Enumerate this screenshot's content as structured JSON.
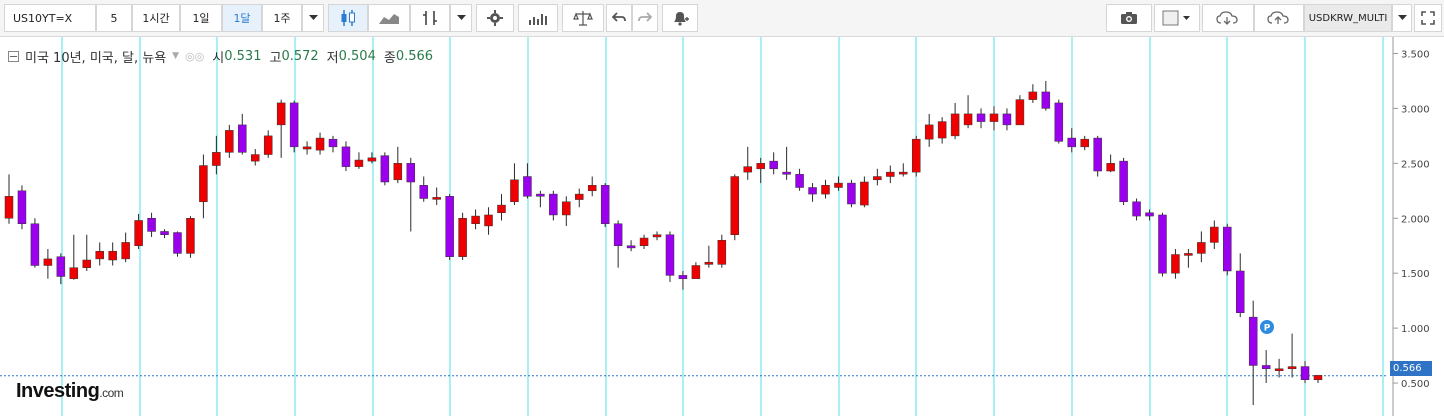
{
  "toolbar": {
    "symbol": "US10YT=X",
    "intervals": [
      "5",
      "1시간",
      "1일",
      "1달",
      "1주"
    ],
    "active_interval": "1달",
    "compare_symbol": "USDKRW_MULTI"
  },
  "legend": {
    "title": "미국 10년, 미국, 달, 뉴욕",
    "open_label": "시",
    "open": "0.531",
    "high_label": "고",
    "high": "0.572",
    "low_label": "저",
    "low": "0.504",
    "close_label": "종",
    "close": "0.566"
  },
  "colors": {
    "up": "#ee0000",
    "down": "#9b00ee",
    "grid": "#4fe0e8",
    "badge": "#2e73c6"
  },
  "price_badge": "0.566",
  "marker_label": "P",
  "logo": {
    "main": "Investing",
    "suffix": ".com"
  },
  "chart_data": {
    "type": "candlestick",
    "y_ticks": [
      "3.500",
      "3.000",
      "2.500",
      "2.000",
      "1.500",
      "1.000",
      "0.500"
    ],
    "y_tick_values": [
      3.5,
      3.0,
      2.5,
      2.0,
      1.5,
      1.0,
      0.5
    ],
    "ylim": [
      0.2,
      3.65
    ],
    "current_price": 0.566,
    "candles": [
      [
        2.0,
        2.2,
        2.4,
        1.95
      ],
      [
        2.25,
        1.95,
        2.3,
        1.9
      ],
      [
        1.95,
        1.57,
        2.0,
        1.55
      ],
      [
        1.57,
        1.63,
        1.72,
        1.45
      ],
      [
        1.65,
        1.47,
        1.68,
        1.4
      ],
      [
        1.45,
        1.55,
        1.85,
        1.44
      ],
      [
        1.55,
        1.62,
        1.85,
        1.52
      ],
      [
        1.63,
        1.7,
        1.78,
        1.57
      ],
      [
        1.62,
        1.7,
        1.78,
        1.57
      ],
      [
        1.63,
        1.78,
        1.87,
        1.6
      ],
      [
        1.75,
        1.98,
        2.04,
        1.72
      ],
      [
        2.0,
        1.88,
        2.05,
        1.83
      ],
      [
        1.88,
        1.85,
        1.9,
        1.82
      ],
      [
        1.87,
        1.68,
        1.88,
        1.65
      ],
      [
        1.68,
        2.0,
        2.02,
        1.64
      ],
      [
        2.15,
        2.48,
        2.58,
        2.0
      ],
      [
        2.48,
        2.6,
        2.75,
        2.4
      ],
      [
        2.6,
        2.8,
        2.85,
        2.55
      ],
      [
        2.85,
        2.6,
        2.95,
        2.58
      ],
      [
        2.52,
        2.58,
        2.63,
        2.48
      ],
      [
        2.58,
        2.75,
        2.8,
        2.55
      ],
      [
        2.85,
        3.05,
        3.08,
        2.55
      ],
      [
        3.05,
        2.65,
        3.07,
        2.6
      ],
      [
        2.63,
        2.65,
        2.7,
        2.58
      ],
      [
        2.62,
        2.73,
        2.78,
        2.58
      ],
      [
        2.72,
        2.65,
        2.75,
        2.6
      ],
      [
        2.65,
        2.47,
        2.7,
        2.43
      ],
      [
        2.47,
        2.53,
        2.6,
        2.45
      ],
      [
        2.52,
        2.55,
        2.6,
        2.5
      ],
      [
        2.57,
        2.33,
        2.6,
        2.3
      ],
      [
        2.35,
        2.5,
        2.65,
        2.32
      ],
      [
        2.5,
        2.33,
        2.55,
        1.88
      ],
      [
        2.3,
        2.18,
        2.38,
        2.15
      ],
      [
        2.18,
        2.19,
        2.28,
        2.12
      ],
      [
        2.2,
        1.65,
        2.22,
        1.62
      ],
      [
        1.65,
        2.0,
        2.05,
        1.62
      ],
      [
        1.95,
        2.02,
        2.08,
        1.9
      ],
      [
        1.93,
        2.03,
        2.1,
        1.85
      ],
      [
        2.05,
        2.12,
        2.22,
        1.98
      ],
      [
        2.15,
        2.35,
        2.5,
        2.12
      ],
      [
        2.38,
        2.2,
        2.5,
        2.18
      ],
      [
        2.22,
        2.2,
        2.25,
        2.1
      ],
      [
        2.22,
        2.03,
        2.25,
        1.98
      ],
      [
        2.03,
        2.15,
        2.2,
        1.93
      ],
      [
        2.17,
        2.22,
        2.27,
        2.1
      ],
      [
        2.25,
        2.3,
        2.38,
        2.2
      ],
      [
        2.3,
        1.95,
        2.32,
        1.92
      ],
      [
        1.95,
        1.75,
        1.98,
        1.55
      ],
      [
        1.75,
        1.73,
        1.8,
        1.7
      ],
      [
        1.75,
        1.82,
        1.85,
        1.72
      ],
      [
        1.83,
        1.85,
        1.88,
        1.8
      ],
      [
        1.85,
        1.48,
        1.88,
        1.42
      ],
      [
        1.48,
        1.45,
        1.52,
        1.35
      ],
      [
        1.45,
        1.57,
        1.6,
        1.45
      ],
      [
        1.58,
        1.6,
        1.75,
        1.55
      ],
      [
        1.58,
        1.8,
        1.85,
        1.55
      ],
      [
        1.85,
        2.38,
        2.4,
        1.8
      ],
      [
        2.42,
        2.47,
        2.65,
        2.35
      ],
      [
        2.45,
        2.5,
        2.55,
        2.32
      ],
      [
        2.52,
        2.45,
        2.6,
        2.4
      ],
      [
        2.42,
        2.4,
        2.65,
        2.35
      ],
      [
        2.4,
        2.28,
        2.45,
        2.25
      ],
      [
        2.28,
        2.22,
        2.32,
        2.15
      ],
      [
        2.22,
        2.3,
        2.35,
        2.18
      ],
      [
        2.28,
        2.32,
        2.38,
        2.25
      ],
      [
        2.32,
        2.13,
        2.35,
        2.1
      ],
      [
        2.12,
        2.33,
        2.38,
        2.1
      ],
      [
        2.35,
        2.38,
        2.45,
        2.3
      ],
      [
        2.38,
        2.42,
        2.48,
        2.32
      ],
      [
        2.42,
        2.42,
        2.5,
        2.38
      ],
      [
        2.42,
        2.72,
        2.75,
        2.38
      ],
      [
        2.72,
        2.85,
        2.95,
        2.65
      ],
      [
        2.73,
        2.88,
        2.92,
        2.68
      ],
      [
        2.75,
        2.95,
        3.05,
        2.72
      ],
      [
        2.85,
        2.95,
        3.12,
        2.82
      ],
      [
        2.95,
        2.88,
        3.0,
        2.82
      ],
      [
        2.88,
        2.95,
        3.02,
        2.8
      ],
      [
        2.95,
        2.85,
        3.0,
        2.8
      ],
      [
        2.85,
        3.08,
        3.12,
        2.85
      ],
      [
        3.08,
        3.15,
        3.22,
        3.05
      ],
      [
        3.15,
        3.0,
        3.25,
        2.98
      ],
      [
        3.05,
        2.7,
        3.08,
        2.68
      ],
      [
        2.73,
        2.65,
        2.82,
        2.6
      ],
      [
        2.65,
        2.72,
        2.75,
        2.62
      ],
      [
        2.73,
        2.43,
        2.75,
        2.38
      ],
      [
        2.43,
        2.5,
        2.58,
        2.42
      ],
      [
        2.52,
        2.15,
        2.55,
        2.12
      ],
      [
        2.15,
        2.02,
        2.18,
        1.98
      ],
      [
        2.05,
        2.02,
        2.08,
        1.98
      ],
      [
        2.03,
        1.5,
        2.05,
        1.47
      ],
      [
        1.5,
        1.67,
        1.72,
        1.45
      ],
      [
        1.67,
        1.68,
        1.72,
        1.55
      ],
      [
        1.68,
        1.78,
        1.88,
        1.6
      ],
      [
        1.78,
        1.92,
        1.98,
        1.72
      ],
      [
        1.92,
        1.52,
        1.95,
        1.48
      ],
      [
        1.52,
        1.14,
        1.68,
        1.1
      ],
      [
        1.1,
        0.66,
        1.25,
        0.3
      ],
      [
        0.66,
        0.63,
        0.8,
        0.5
      ],
      [
        0.63,
        0.63,
        0.72,
        0.55
      ],
      [
        0.63,
        0.65,
        0.95,
        0.55
      ],
      [
        0.65,
        0.53,
        0.7,
        0.5
      ],
      [
        0.53,
        0.57,
        0.57,
        0.5
      ]
    ]
  }
}
